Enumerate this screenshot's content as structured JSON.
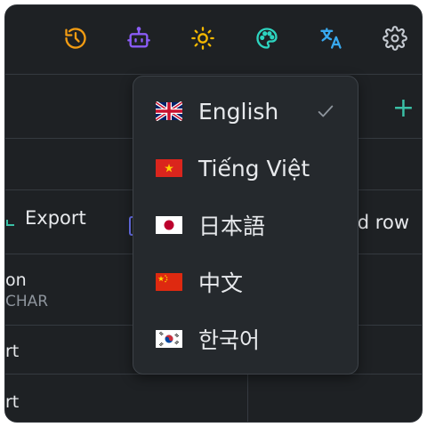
{
  "toolbar": {
    "icons": [
      "history-icon",
      "robot-icon",
      "sun-icon",
      "palette-icon",
      "translate-icon",
      "gear-icon"
    ]
  },
  "toolbar_actions": {
    "add": "+",
    "export_label": "Export",
    "add_row_label": "d row"
  },
  "table": {
    "cell_name_partial": "on",
    "cell_type_partial": "CHAR",
    "row2_partial": "rt",
    "row3_partial": "rt"
  },
  "language_menu": {
    "selected": "English",
    "items": [
      {
        "label": "English",
        "flag": "uk-flag-icon",
        "checked": true
      },
      {
        "label": "Tiếng Việt",
        "flag": "vietnam-flag-icon",
        "checked": false
      },
      {
        "label": "日本語",
        "flag": "japan-flag-icon",
        "checked": false
      },
      {
        "label": "中文",
        "flag": "china-flag-icon",
        "checked": false
      },
      {
        "label": "한국어",
        "flag": "korea-flag-icon",
        "checked": false
      }
    ]
  },
  "colors": {
    "background": "#1e2124",
    "menu_bg": "#25292d",
    "accent_teal": "#3ac0a6",
    "history_orange": "#f39c12",
    "robot_purple": "#8b5cf6",
    "sun_yellow": "#f5b800",
    "palette_teal": "#2dd4bf",
    "translate_blue": "#38a9f0",
    "gear_gray": "#c5cad1"
  }
}
